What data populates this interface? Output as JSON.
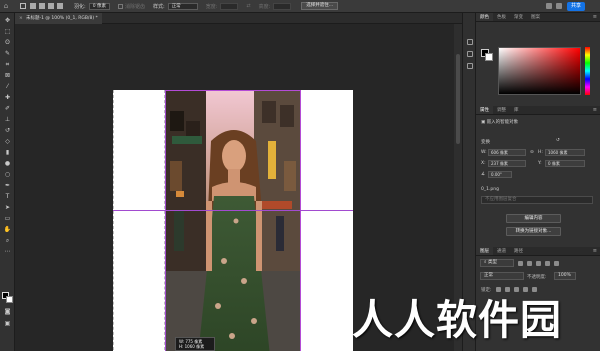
{
  "options_bar": {
    "feather_label": "羽化:",
    "feather_value": "0 像素",
    "antialias_label": "消除锯齿",
    "style_label": "样式:",
    "style_value": "正常",
    "width_label": "宽度:",
    "height_label": "高度:",
    "select_mask_button": "选择并遮住...",
    "share_button": "共享"
  },
  "document_tab": {
    "title": "未标题-1 @ 100% (0_1, RGB/8) *"
  },
  "canvas": {
    "info_w": "W:  775 像素",
    "info_h": "H: 1060 像素"
  },
  "color_panel": {
    "tabs": [
      "颜色",
      "色板",
      "渐变",
      "图案"
    ],
    "active_tab": "颜色"
  },
  "properties_panel": {
    "tabs": [
      "属性",
      "调整",
      "库"
    ],
    "active_tab": "属性",
    "layer_type": "嵌入的智能对象",
    "transform_label": "变换",
    "w_label": "W:",
    "w_value": "606 像素",
    "h_label": "H:",
    "h_value": "1060 像素",
    "x_label": "X:",
    "x_value": "237 像素",
    "y_label": "Y:",
    "y_value": "0 像素",
    "angle_value": "0.00°",
    "file_name": "0_1.png",
    "no_comps": "不应用图层复合",
    "edit_contents_button": "编辑内容",
    "convert_button": "转换为链接对象..."
  },
  "layers_panel": {
    "tabs": [
      "图层",
      "通道",
      "路径"
    ],
    "active_tab": "图层",
    "filter_value": "类型",
    "blend_mode": "正常",
    "opacity_label": "不透明度:",
    "opacity_value": "100%",
    "lock_label": "锁定:"
  },
  "watermark": {
    "text": "人人软件园"
  }
}
